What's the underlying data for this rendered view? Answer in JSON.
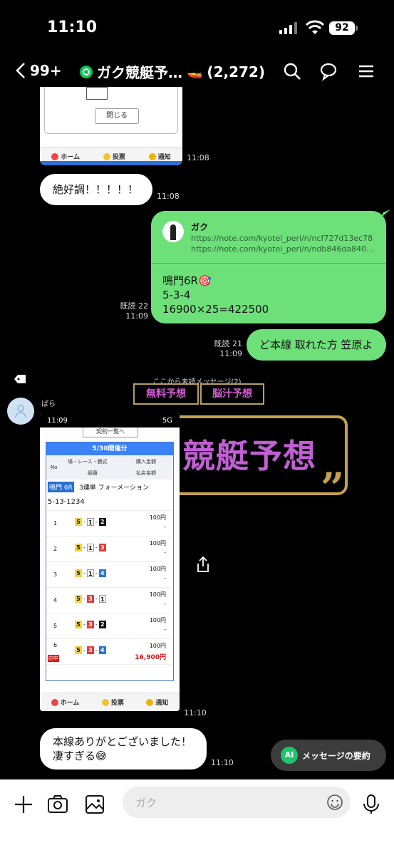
{
  "status_bar": {
    "time": "11:10",
    "battery": "92"
  },
  "header": {
    "back_count": "99+",
    "room_title": "ガク競艇予…",
    "member_count": "(2,272)"
  },
  "top_card": {
    "close_label": "閉じる",
    "nav": [
      "ホーム",
      "投票",
      "通知"
    ],
    "timestamp": "11:08"
  },
  "msg1": {
    "text": "絶好調！！！！！",
    "timestamp": "11:08"
  },
  "link_message": {
    "sender": "ガク",
    "url1": "https://note.com/kyotei_peri/n/ncf727d13ec78",
    "url2": "https://note.com/kyotei_peri/n/ndb846da840...",
    "line1": "鳴門6R🎯",
    "line2": "5-3-4",
    "line3": "16900×25=422500",
    "read": "既読 22",
    "timestamp": "11:09"
  },
  "msg2": {
    "text": "ど本線 取れた方 笠原よ",
    "read": "既読 21",
    "timestamp": "11:09"
  },
  "unread_divider": "ここから未読メッセージ(2)",
  "promo": {
    "box1": "無料予想",
    "box2": "脳汁予想",
    "big": "競艇予想",
    "quote": "”"
  },
  "sender2": "ぱら",
  "shot": {
    "status_time": "11:09",
    "status_right": "5G",
    "top_button": "契約一覧へ",
    "date": "5/30開催分",
    "head_no": "No",
    "head_race": "場・レース・勝式",
    "head_race2": "組番",
    "head_buy": "購入金額",
    "head_pay": "払戻金額",
    "race_tag": "鳴門 6R",
    "race_type": "3連単 フォーメーション",
    "combo_text": "5-13-1234",
    "rows": [
      {
        "no": "1",
        "a": "5",
        "b": "1",
        "c": "2",
        "amount": "100円"
      },
      {
        "no": "2",
        "a": "5",
        "b": "1",
        "c": "3",
        "amount": "100円"
      },
      {
        "no": "3",
        "a": "5",
        "b": "1",
        "c": "4",
        "amount": "100円"
      },
      {
        "no": "4",
        "a": "5",
        "b": "3",
        "c": "1",
        "amount": "100円"
      },
      {
        "no": "5",
        "a": "5",
        "b": "3",
        "c": "2",
        "amount": "100円"
      },
      {
        "no": "6",
        "a": "5",
        "b": "3",
        "c": "4",
        "amount": "100円",
        "payout": "16,900円",
        "hit": "的中"
      }
    ],
    "dash": "-",
    "page": "1",
    "nav": [
      "ホーム",
      "投票",
      "通知"
    ],
    "timestamp": "11:10"
  },
  "msg3": {
    "line1": "本線ありがとございました！",
    "line2": "凄すぎる😅",
    "timestamp": "11:10"
  },
  "ai_button": {
    "icon": "AI",
    "label": "メッセージの要約"
  },
  "input": {
    "placeholder": "ガク"
  }
}
